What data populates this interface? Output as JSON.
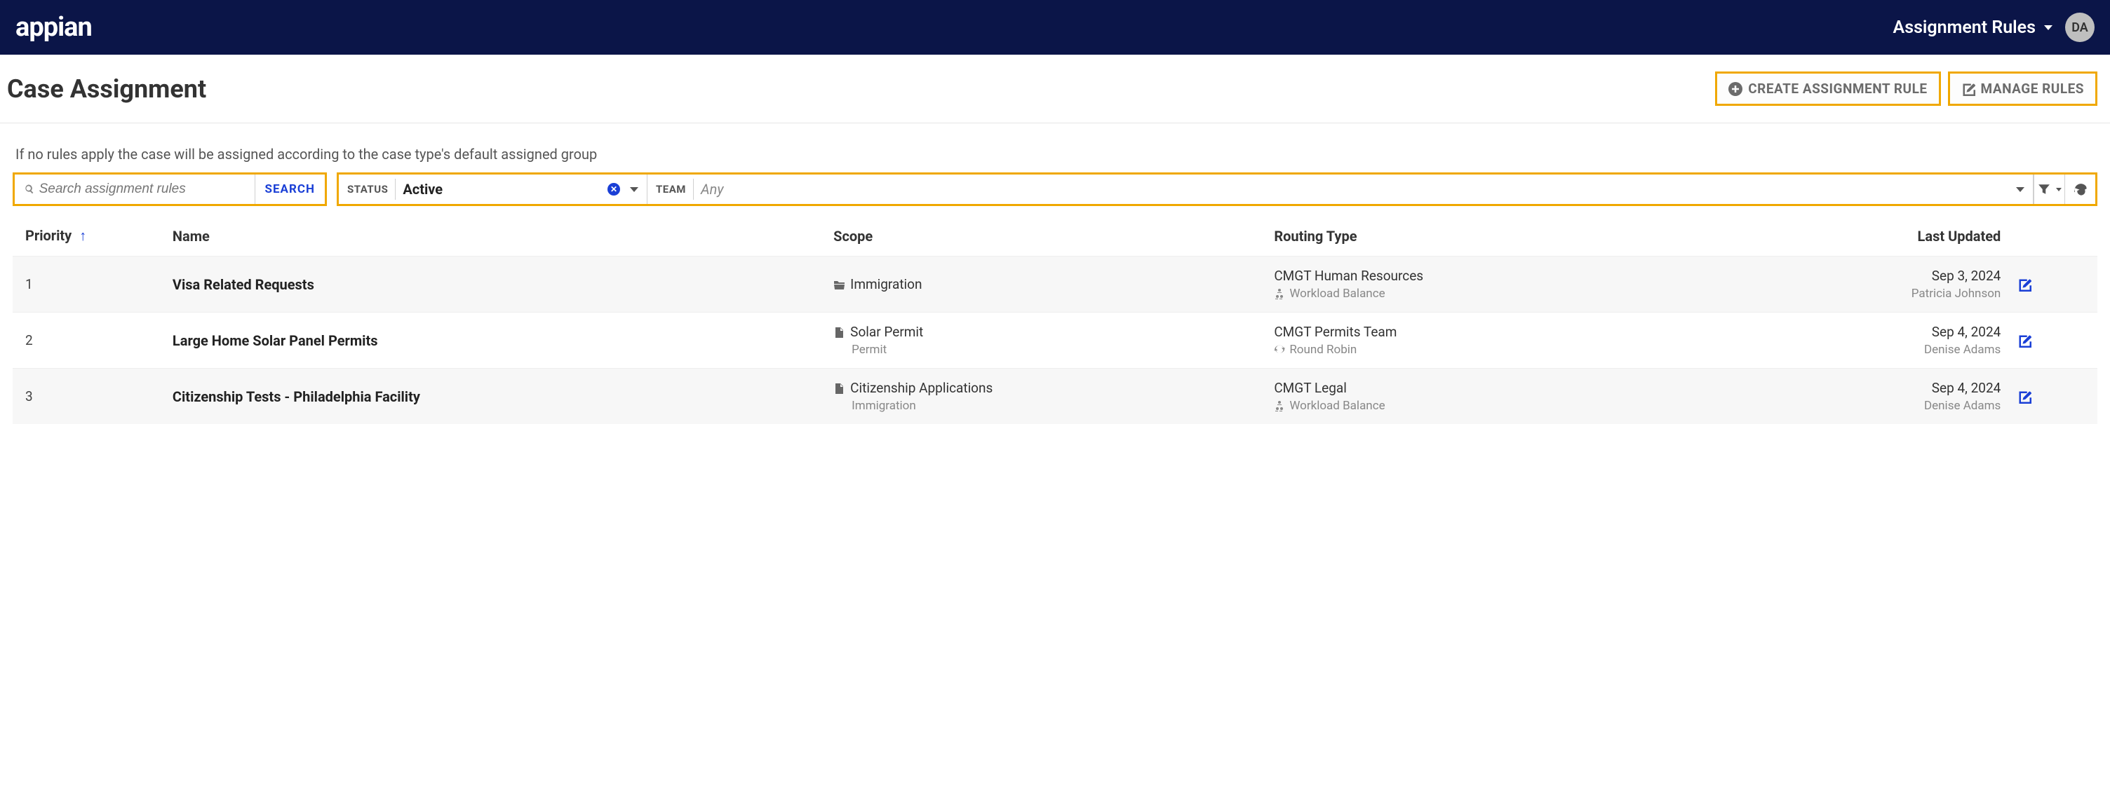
{
  "header": {
    "brand": "appian",
    "nav_label": "Assignment Rules",
    "avatar_initials": "DA"
  },
  "page": {
    "title": "Case Assignment",
    "create_btn": "CREATE ASSIGNMENT RULE",
    "manage_btn": "MANAGE RULES",
    "helper": "If no rules apply the case will be assigned according to the case type's default assigned group"
  },
  "search": {
    "placeholder": "Search assignment rules",
    "button": "SEARCH"
  },
  "filters": {
    "status_label": "STATUS",
    "status_value": "Active",
    "team_label": "TEAM",
    "team_value": "Any"
  },
  "columns": {
    "priority": "Priority",
    "name": "Name",
    "scope": "Scope",
    "routing": "Routing Type",
    "updated": "Last Updated"
  },
  "rows": [
    {
      "priority": "1",
      "name": "Visa Related Requests",
      "scope_icon": "folder",
      "scope": "Immigration",
      "scope_sub": "",
      "route": "CMGT Human Resources",
      "route_sub_icon": "workload",
      "route_sub": "Workload Balance",
      "updated": "Sep 3, 2024",
      "updated_by": "Patricia Johnson"
    },
    {
      "priority": "2",
      "name": "Large Home Solar Panel Permits",
      "scope_icon": "file",
      "scope": "Solar Permit",
      "scope_sub": "Permit",
      "route": "CMGT Permits Team",
      "route_sub_icon": "roundrobin",
      "route_sub": "Round Robin",
      "updated": "Sep 4, 2024",
      "updated_by": "Denise Adams"
    },
    {
      "priority": "3",
      "name": "Citizenship Tests - Philadelphia Facility",
      "scope_icon": "file",
      "scope": "Citizenship Applications",
      "scope_sub": "Immigration",
      "route": "CMGT Legal",
      "route_sub_icon": "workload",
      "route_sub": "Workload Balance",
      "updated": "Sep 4, 2024",
      "updated_by": "Denise Adams"
    }
  ]
}
